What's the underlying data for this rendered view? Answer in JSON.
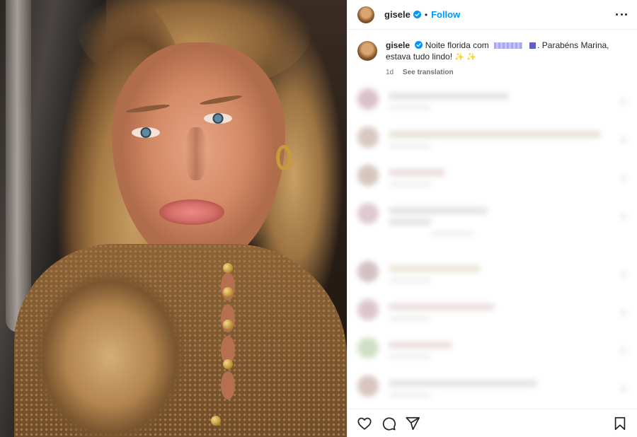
{
  "post": {
    "username": "gisele",
    "verified": true,
    "follow_label": "Follow",
    "separator": "•"
  },
  "caption": {
    "username": "gisele",
    "text_before": "Noite florida com",
    "text_after": ". Parabéns Marina, estava tudo lindo!",
    "emoji": "✨ ✨",
    "age": "1d",
    "see_translation": "See translation"
  },
  "icons": {
    "more": "more-options-icon",
    "verified": "verified-badge-icon",
    "like": "heart-icon",
    "comment": "comment-icon",
    "share": "share-icon",
    "save": "bookmark-icon"
  },
  "colors": {
    "follow": "#0095f6",
    "verified": "#0095f6",
    "meta": "#737373"
  }
}
